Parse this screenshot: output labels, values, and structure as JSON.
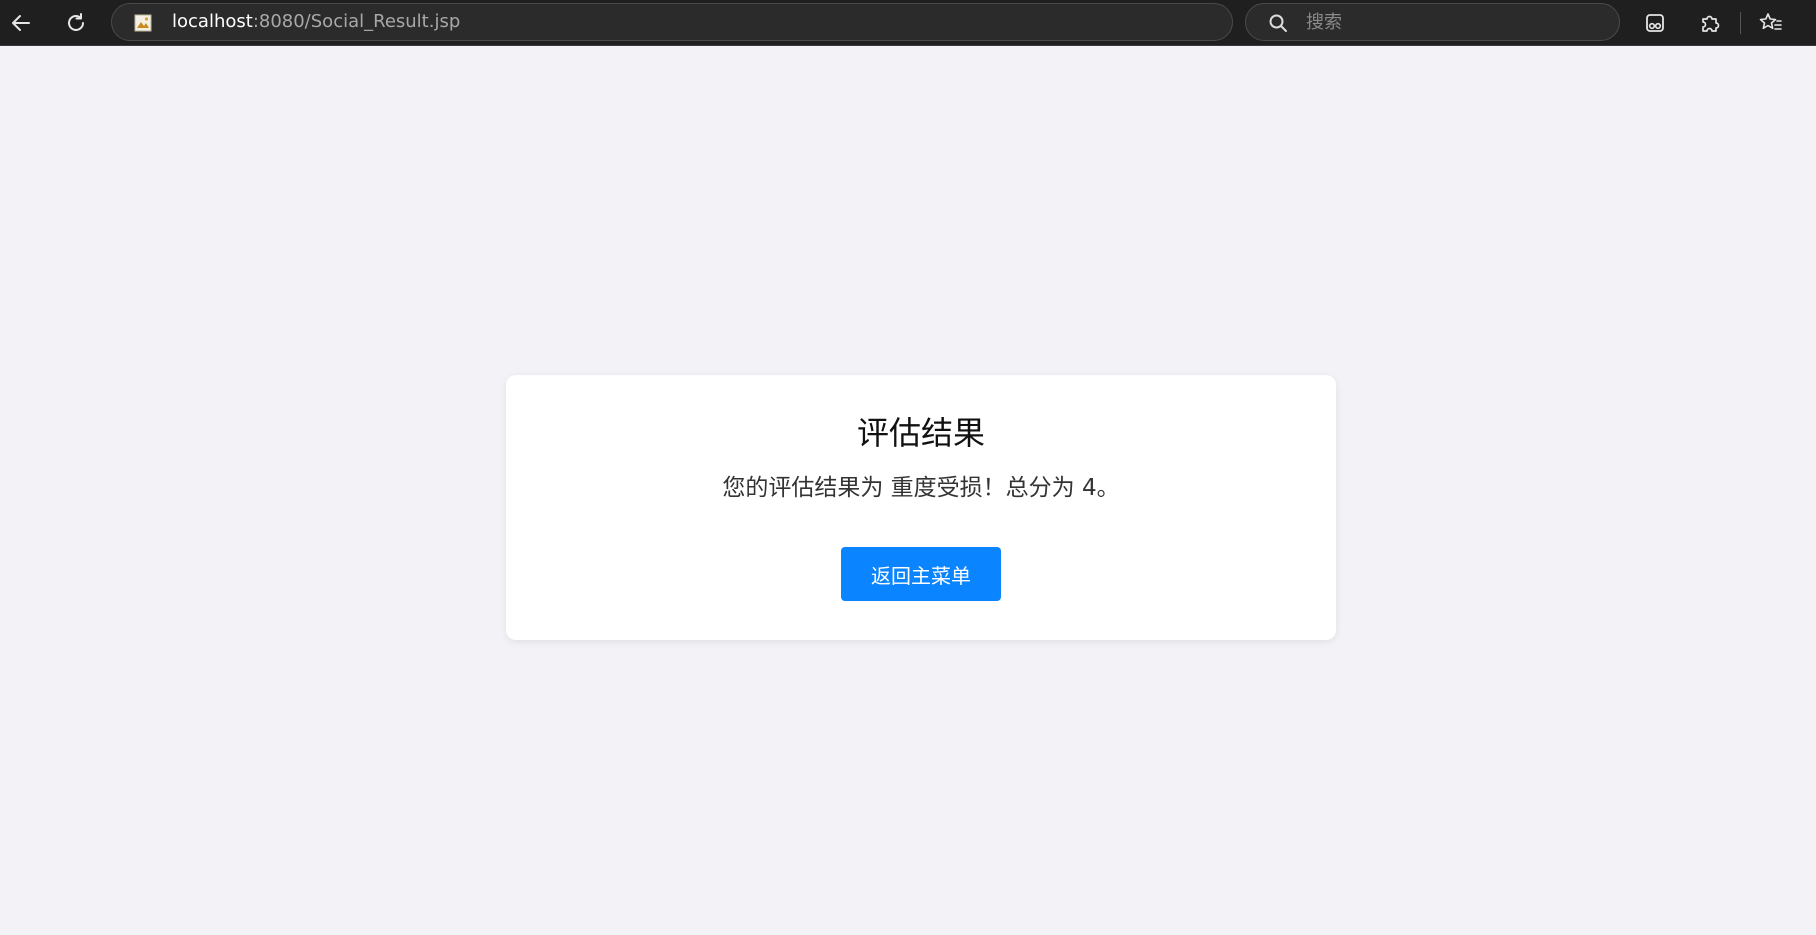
{
  "browser": {
    "address_bar": {
      "host": "localhost",
      "path": ":8080/Social_Result.jsp"
    },
    "search": {
      "placeholder": "搜索"
    },
    "icons": [
      "back-arrow-icon",
      "reload-icon",
      "site-favicon",
      "search-icon",
      "extension-icon",
      "puzzle-icon",
      "favorites-icon"
    ]
  },
  "page": {
    "title": "评估结果",
    "message": "您的评估结果为 重度受损！总分为 4。",
    "return_button_label": "返回主菜单"
  },
  "colors": {
    "page_background": "#f3f3f7",
    "card_background": "#ffffff",
    "button_background": "#0a84ff",
    "toolbar_background": "#1f1f1f"
  }
}
